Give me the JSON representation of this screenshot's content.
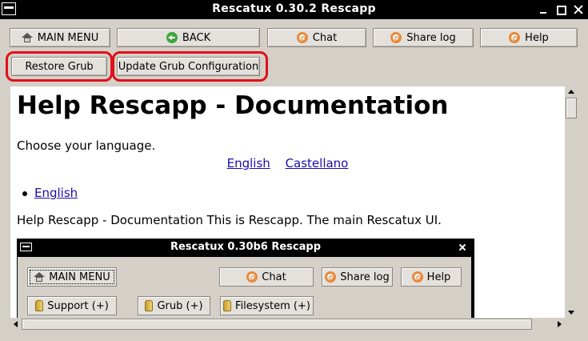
{
  "window": {
    "title": "Rescatux 0.30.2 Rescapp"
  },
  "toolbar": {
    "main_menu": "MAIN MENU",
    "back": "BACK",
    "chat": "Chat",
    "share_log": "Share log",
    "help": "Help",
    "restore_grub": "Restore Grub",
    "update_grub": "Update Grub Configuration"
  },
  "icons": {
    "main_menu": "home-icon",
    "back": "back-arrow-icon",
    "chat": "lifebuoy-icon",
    "share_log": "lifebuoy-icon",
    "help": "lifebuoy-icon",
    "support": "shovel-icon"
  },
  "highlight_color": "#e0101a",
  "document": {
    "heading": "Help Rescapp - Documentation",
    "choose_language": "Choose your language.",
    "languages": [
      "English",
      "Castellano"
    ],
    "bullet_link": "English",
    "intro": "Help Rescapp - Documentation This is Rescapp. The main Rescatux UI."
  },
  "embedded_screenshot": {
    "title": "Rescatux 0.30b6 Rescapp",
    "main_menu": "MAIN MENU",
    "chat": "Chat",
    "share_log": "Share log",
    "help": "Help",
    "support": "Support (+)",
    "grub": "Grub (+)",
    "filesystem": "Filesystem (+)"
  }
}
